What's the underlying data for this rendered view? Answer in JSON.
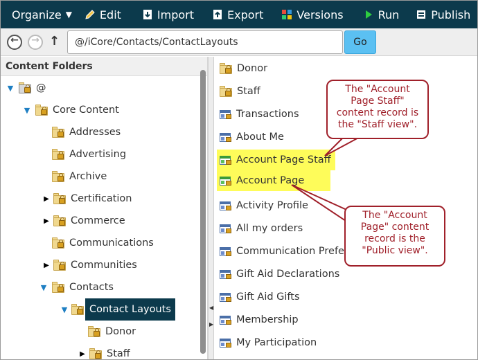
{
  "toolbar": {
    "organize": "Organize",
    "edit": "Edit",
    "import": "Import",
    "export": "Export",
    "versions": "Versions",
    "run": "Run",
    "publish": "Publish"
  },
  "address": {
    "path": "@/iCore/Contacts/ContactLayouts",
    "go_label": "Go"
  },
  "left": {
    "header": "Content Folders",
    "tree": [
      {
        "label": "@",
        "expanded": true,
        "level": 0
      },
      {
        "label": "Core Content",
        "expanded": true,
        "level": 1
      },
      {
        "label": "Addresses",
        "level": 2
      },
      {
        "label": "Advertising",
        "level": 2
      },
      {
        "label": "Archive",
        "level": 2
      },
      {
        "label": "Certification",
        "level": 2,
        "collapsed": true
      },
      {
        "label": "Commerce",
        "level": 2,
        "collapsed": true
      },
      {
        "label": "Communications",
        "level": 2
      },
      {
        "label": "Communities",
        "level": 2,
        "collapsed": true
      },
      {
        "label": "Contacts",
        "expanded": true,
        "level": 2
      },
      {
        "label": "Contact Layouts",
        "expanded": true,
        "level": 3,
        "selected": true
      },
      {
        "label": "Donor",
        "level": 4
      },
      {
        "label": "Staff",
        "level": 4,
        "collapsed": true
      }
    ]
  },
  "right": {
    "items": [
      {
        "label": "Donor",
        "type": "folder"
      },
      {
        "label": "Staff",
        "type": "folder"
      },
      {
        "label": "Transactions",
        "type": "record"
      },
      {
        "label": "About Me",
        "type": "record"
      },
      {
        "label": "Account Page Staff",
        "type": "record-green",
        "highlighted": true
      },
      {
        "label": "Account Page",
        "type": "record-green",
        "highlighted": true
      },
      {
        "label": "Activity Profile",
        "type": "record"
      },
      {
        "label": "All my orders",
        "type": "record"
      },
      {
        "label": "Communication Prefer",
        "type": "record"
      },
      {
        "label": "Gift Aid Declarations",
        "type": "record"
      },
      {
        "label": "Gift Aid Gifts",
        "type": "record"
      },
      {
        "label": "Membership",
        "type": "record"
      },
      {
        "label": "My Participation",
        "type": "record"
      }
    ]
  },
  "callouts": {
    "staff": [
      "The \"Account",
      "Page Staff\"",
      "content record is",
      "the \"Staff view\"."
    ],
    "public": [
      "The \"Account",
      "Page\" content",
      "record is the",
      "\"Public view\"."
    ]
  },
  "colors": {
    "toolbar_bg": "#0c3a4c",
    "highlight": "#fefc5a",
    "callout": "#a0202a",
    "go_button": "#5bc0f2"
  }
}
